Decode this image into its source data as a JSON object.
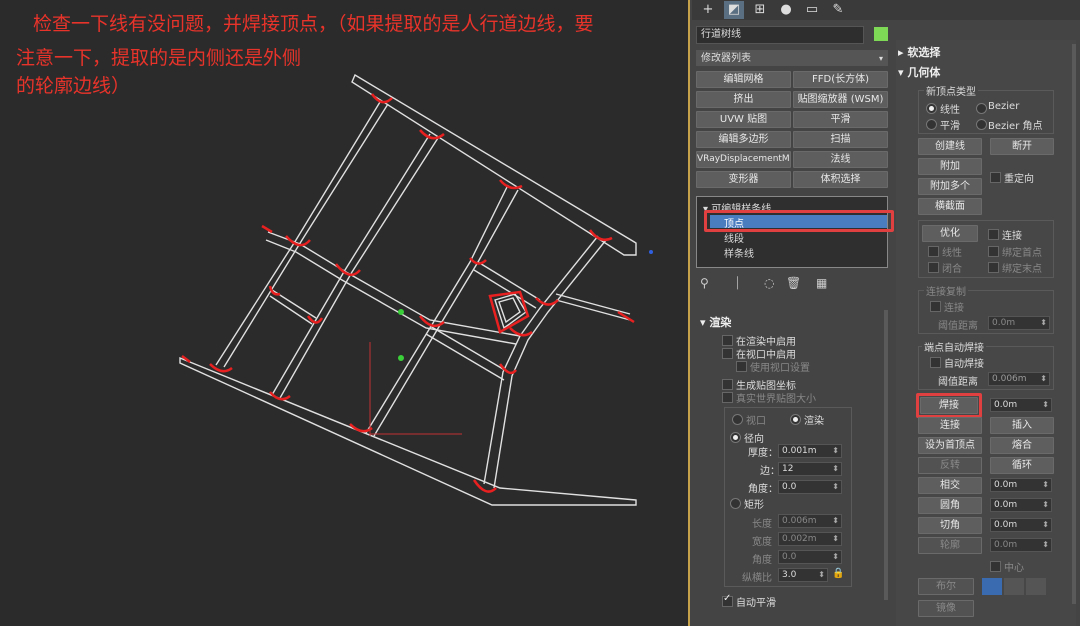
{
  "annotation": {
    "line1": "检查一下线有没问题，并焊接顶点，（如果提取的是人行道边线，要",
    "line2": "注意一下，提取的是内侧还是外侧",
    "line3": "的轮廓边线）"
  },
  "panel": {
    "object_name": "行道树线",
    "modifier_list": "修改器列表",
    "modifier_buttons": [
      "编辑网格",
      "FFD(长方体)",
      "挤出",
      "贴图缩放器 (WSM)",
      "UVW 贴图",
      "平滑",
      "编辑多边形",
      "扫描",
      "VRayDisplacementMod",
      "法线",
      "变形器",
      "体积选择"
    ],
    "stack": {
      "root": "可编辑样条线",
      "items": [
        "顶点",
        "线段",
        "样条线"
      ]
    },
    "render": {
      "header": "渲染",
      "enable_render": "在渲染中启用",
      "enable_viewport": "在视口中启用",
      "use_viewport_settings": "使用视口设置",
      "gen_map_coords": "生成贴图坐标",
      "real_world_map": "真实世界贴图大小",
      "viewport_radio": "视口",
      "render_radio": "渲染",
      "radial": "径向",
      "thickness_label": "厚度：",
      "thickness_value": "0.001m",
      "sides_label": "边：",
      "sides_value": "12",
      "angle_label": "角度：",
      "angle_value": "0.0",
      "rect": "矩形",
      "length_label": "长度",
      "length_value": "0.006m",
      "width_label": "宽度",
      "width_value": "0.002m",
      "angle2_label": "角度",
      "angle2_value": "0.0",
      "aspect_label": "纵横比",
      "aspect_value": "3.0",
      "auto_smooth": "自动平滑"
    },
    "soft_select": "软选择",
    "geometry": {
      "header": "几何体",
      "new_vertex_type": "新顶点类型",
      "linear": "线性",
      "bezier": "Bezier",
      "smooth": "平滑",
      "bezier_corner": "Bezier 角点",
      "create_line": "创建线",
      "break": "断开",
      "attach": "附加",
      "attach_multi": "附加多个",
      "reorient": "重定向",
      "cross_section": "横截面",
      "refine": "优化",
      "connect": "连接",
      "linear2": "线性",
      "bind_first": "绑定首点",
      "close": "闭合",
      "bind_last": "绑定末点",
      "connect_copy": "连接复制",
      "connect2": "连接",
      "threshold": "阈值距离",
      "threshold_value": "0.0m",
      "endpoint_weld": "端点自动焊接",
      "auto_weld": "自动焊接",
      "threshold2": "阈值距离",
      "threshold2_value": "0.006m",
      "weld": "焊接",
      "weld_value": "0.0m",
      "connect3": "连接",
      "insert": "插入",
      "make_first": "设为首顶点",
      "fuse": "熔合",
      "reverse": "反转",
      "cycle": "循环",
      "intersect": "相交",
      "intersect_value": "0.0m",
      "fillet": "圆角",
      "fillet_value": "0.0m",
      "chamfer": "切角",
      "chamfer_value": "0.0m",
      "outline": "轮廓",
      "outline_value": "0.0m",
      "center": "中心",
      "boolean": "布尔",
      "mirror": "镜像"
    }
  },
  "colors": {
    "annotation": "#e8332a",
    "highlight": "#e04040",
    "selected": "#4a7cc0",
    "swatch": "#7ed957"
  }
}
